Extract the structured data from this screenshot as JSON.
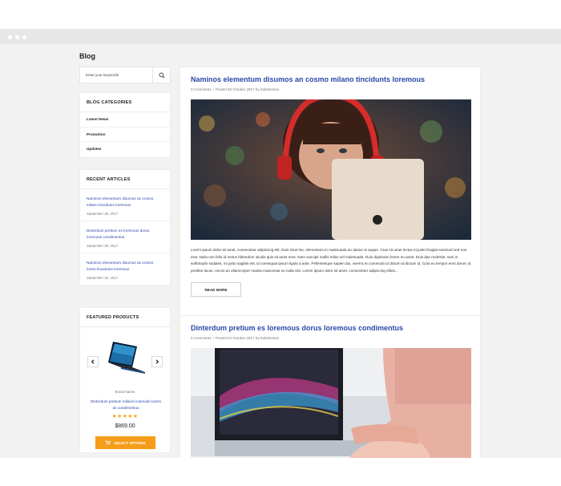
{
  "page": {
    "title": "Blog"
  },
  "search": {
    "placeholder": "Enter your keywords"
  },
  "categories": {
    "title": "BLOG CATEGORIES",
    "items": [
      "Latest News",
      "Promotion",
      "Updates"
    ]
  },
  "recent_articles": {
    "title": "RECENT ARTICLES",
    "items": [
      {
        "title": "Naminos elementum disumos an cosmo milano tincidunts loremous",
        "date": "September 30, 2017"
      },
      {
        "title": "Dinterdum pretium es loremous dorus loremous condimentus",
        "date": "September 30, 2017"
      },
      {
        "title": "Naminos elementum disumos an cosmo lorem tincidunts loremous",
        "date": "September 30, 2017"
      }
    ]
  },
  "featured": {
    "title": "FEATURED PRODUCTS",
    "brand": "Brand Name",
    "name": "Dinterdum pretium milanol cosmodo lorem an condimentus",
    "stars": "★★★★★",
    "rating": 5,
    "price": "$869.00",
    "button": "SELECT OPTIONS"
  },
  "posts": [
    {
      "title": "Naminos elementum disumos an cosmo milano tincidunts loremous",
      "comments": "3 Comments",
      "posted": "Posted 03 October 2017 by halothemes",
      "excerpt": "Lorem ipsum dolor sit amet, consectetur adipiscing elit. Duis risus leo, elementum in malesuada an darius ut augue. Cras sit amet lectus et justo feugiat euismod sed non erat. Nulla non felis id metus bibendum iaculis quis sit amet eros. Nam suscipit mollis tellus vel malesuada. Duis dignissim lorem eu amet. Duis dan molestie, sem in sollicitudin sodales, mi justo sagittis est, id consequat ipsum ligula a ante. Pellentesque sapien dui, viverra et commodo id dictum id dictum id. Cras eu tempor eros donec ut porttitor lacus, necos an ullamcorper massa maecenas eu nulla nisi. Lorem ipsum dolor sit amet, consectetur adipiscing elitos...",
      "read_more": "READ MORE"
    },
    {
      "title": "Dinterdum pretium es loremous dorus loremous condimentus",
      "comments": "0 Comments",
      "posted": "Posted 03 October 2017 by halothemes"
    }
  ],
  "meta_separator": "/",
  "colors": {
    "link": "#2a47a8",
    "accent": "#f59d1a",
    "background": "#f2f2f2"
  }
}
